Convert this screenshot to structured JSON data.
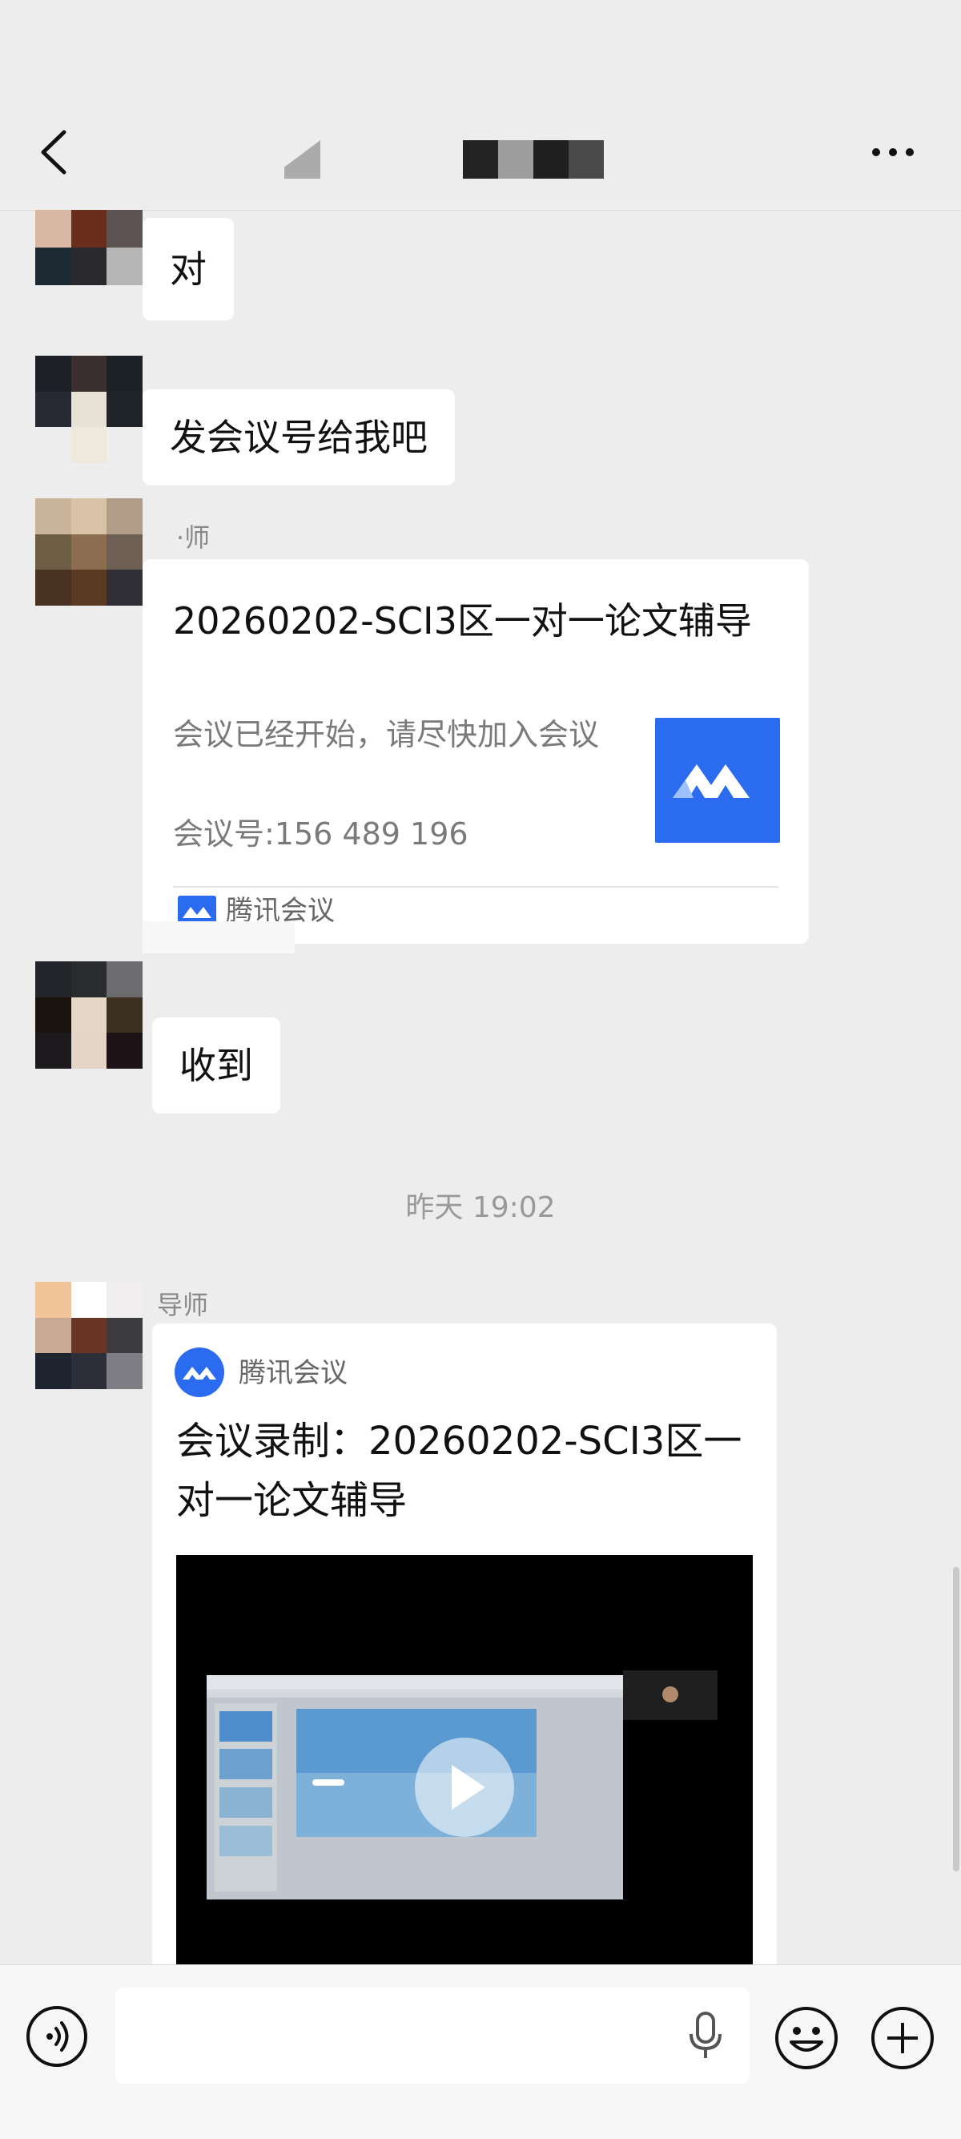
{
  "header": {
    "back_icon": "chevron-left-icon",
    "more_icon": "more-horizontal-icon"
  },
  "messages": [
    {
      "type": "text",
      "text": "对"
    },
    {
      "type": "text",
      "text": "发会议号给我吧"
    },
    {
      "type": "meeting_card",
      "sender": "导师",
      "sender_visible": "·师",
      "title": "20260202-SCI3区一对一论文辅导",
      "description": "会议已经开始，请尽快加入会议",
      "meeting_id": "会议号:156 489 196",
      "source": "腾讯会议"
    },
    {
      "type": "text",
      "text": "收到"
    },
    {
      "type": "timestamp",
      "text": "昨天 19:02"
    },
    {
      "type": "recording_card",
      "sender": "导师",
      "source": "腾讯会议",
      "title": "会议录制：20260202-SCI3区一对一论文辅导",
      "play_icon": "play-icon"
    }
  ],
  "input_bar": {
    "voice_icon": "voice-mode-icon",
    "mic_icon": "microphone-icon",
    "emoji_icon": "emoji-icon",
    "plus_icon": "plus-circle-icon",
    "placeholder": ""
  },
  "colors": {
    "background": "#ededed",
    "bubble": "#ffffff",
    "accent": "#2a6bef"
  }
}
